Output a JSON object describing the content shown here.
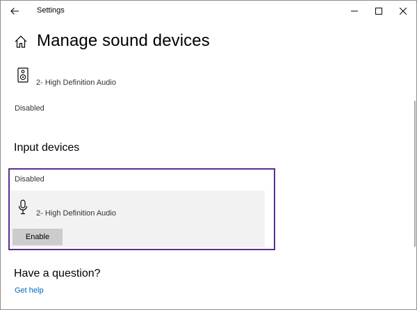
{
  "window": {
    "title": "Settings",
    "controls": {
      "minimize_icon": "minimize-icon",
      "maximize_icon": "maximize-icon",
      "close_icon": "close-icon"
    }
  },
  "header": {
    "back_icon": "back-arrow-icon",
    "home_icon": "home-icon",
    "title": "Manage sound devices"
  },
  "output_devices": {
    "device": {
      "icon": "speaker-icon",
      "name": "2- High Definition Audio"
    },
    "status": "Disabled"
  },
  "input_devices": {
    "heading": "Input devices",
    "status": "Disabled",
    "device": {
      "icon": "microphone-icon",
      "name": "2- High Definition Audio"
    },
    "enable_label": "Enable"
  },
  "help": {
    "heading": "Have a question?",
    "link": "Get help"
  },
  "colors": {
    "highlight_border": "#5b2d8e",
    "link": "#0067b8",
    "card_bg": "#f2f2f2",
    "button_bg": "#cccccc"
  }
}
